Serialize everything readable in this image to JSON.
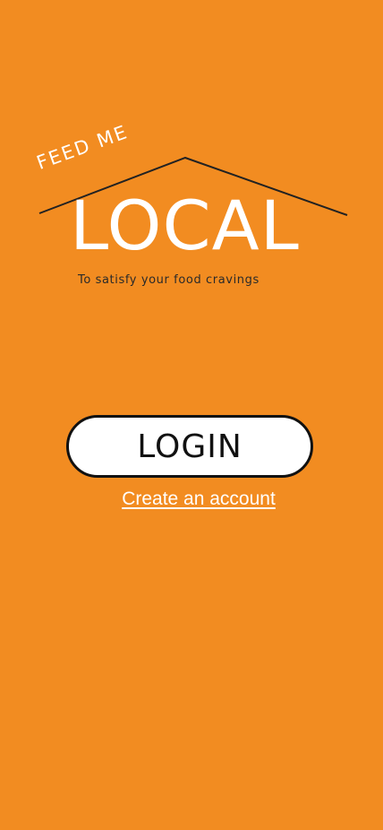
{
  "logo": {
    "feed_me": "FEED ME",
    "title": "LOCAL",
    "tagline": "To satisfy your food cravings"
  },
  "actions": {
    "login_label": "LOGIN",
    "create_account_label": "Create an account"
  },
  "colors": {
    "background": "#F28C21",
    "text_light": "#FFFFFF",
    "text_dark": "#111111",
    "roof_line": "#222222"
  },
  "icons": {
    "roof": "house-roof-icon"
  }
}
